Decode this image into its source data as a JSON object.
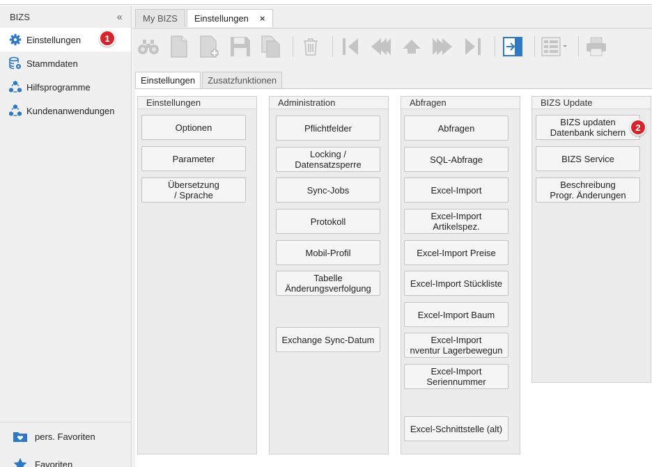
{
  "sidebar": {
    "title": "BIZS",
    "collapse_glyph": "«",
    "items": [
      {
        "label": "Einstellungen",
        "icon": "gear-icon",
        "active": true
      },
      {
        "label": "Stammdaten",
        "icon": "database-icon"
      },
      {
        "label": "Hilfsprogramme",
        "icon": "cube-tools-icon"
      },
      {
        "label": "Kundenanwendungen",
        "icon": "cube-tools-icon"
      }
    ],
    "bottom": [
      {
        "label": "pers. Favoriten",
        "icon": "heart-folder-icon"
      },
      {
        "label": "Favoriten",
        "icon": "star-icon"
      }
    ]
  },
  "badges": {
    "one": "1",
    "two": "2"
  },
  "doc_tabs": [
    {
      "label": "My BIZS",
      "active": false
    },
    {
      "label": "Einstellungen",
      "active": true,
      "close": "×"
    }
  ],
  "toolbar": {
    "icons": [
      "binoculars-icon",
      "new-document-icon",
      "add-document-icon",
      "save-icon",
      "copy-icon",
      "delete-icon",
      "first-record-icon",
      "previous-record-icon",
      "up-icon",
      "next-record-icon",
      "last-record-icon",
      "exit-icon",
      "list-view-icon",
      "print-icon"
    ]
  },
  "sub_tabs": [
    {
      "label": "Einstellungen",
      "active": true
    },
    {
      "label": "Zusatzfunktionen",
      "active": false
    }
  ],
  "groups": {
    "einstellungen": {
      "title": "Einstellungen",
      "buttons": [
        "Optionen",
        "Parameter",
        "Übersetzung\n / Sprache"
      ]
    },
    "administration": {
      "title": "Administration",
      "buttons": [
        "Pflichtfelder",
        "Locking /\nDatensatzsperre",
        "Sync-Jobs",
        "Protokoll",
        "Mobil-Profil",
        "Tabelle\nÄnderungsverfolgung",
        "Exchange Sync-Datum"
      ]
    },
    "abfragen": {
      "title": "Abfragen",
      "buttons": [
        "Abfragen",
        "SQL-Abfrage",
        "Excel-Import",
        "Excel-Import\nArtikelspez.",
        "Excel-Import Preise",
        "Excel-Import Stückliste",
        "Excel-Import Baum",
        "Excel-Import\nnventur Lagerbewegun",
        "Excel-Import\nSeriennummer",
        "Excel-Schnittstelle (alt)"
      ]
    },
    "update": {
      "title": "BIZS Update",
      "buttons": [
        "BIZS updaten\nDatenbank sichern",
        "BIZS Service",
        "Beschreibung\nProgr. Änderungen"
      ]
    }
  },
  "colors": {
    "accent_blue": "#2f78c4",
    "badge_red": "#d9232a",
    "icon_gray": "#c4c4c4"
  }
}
